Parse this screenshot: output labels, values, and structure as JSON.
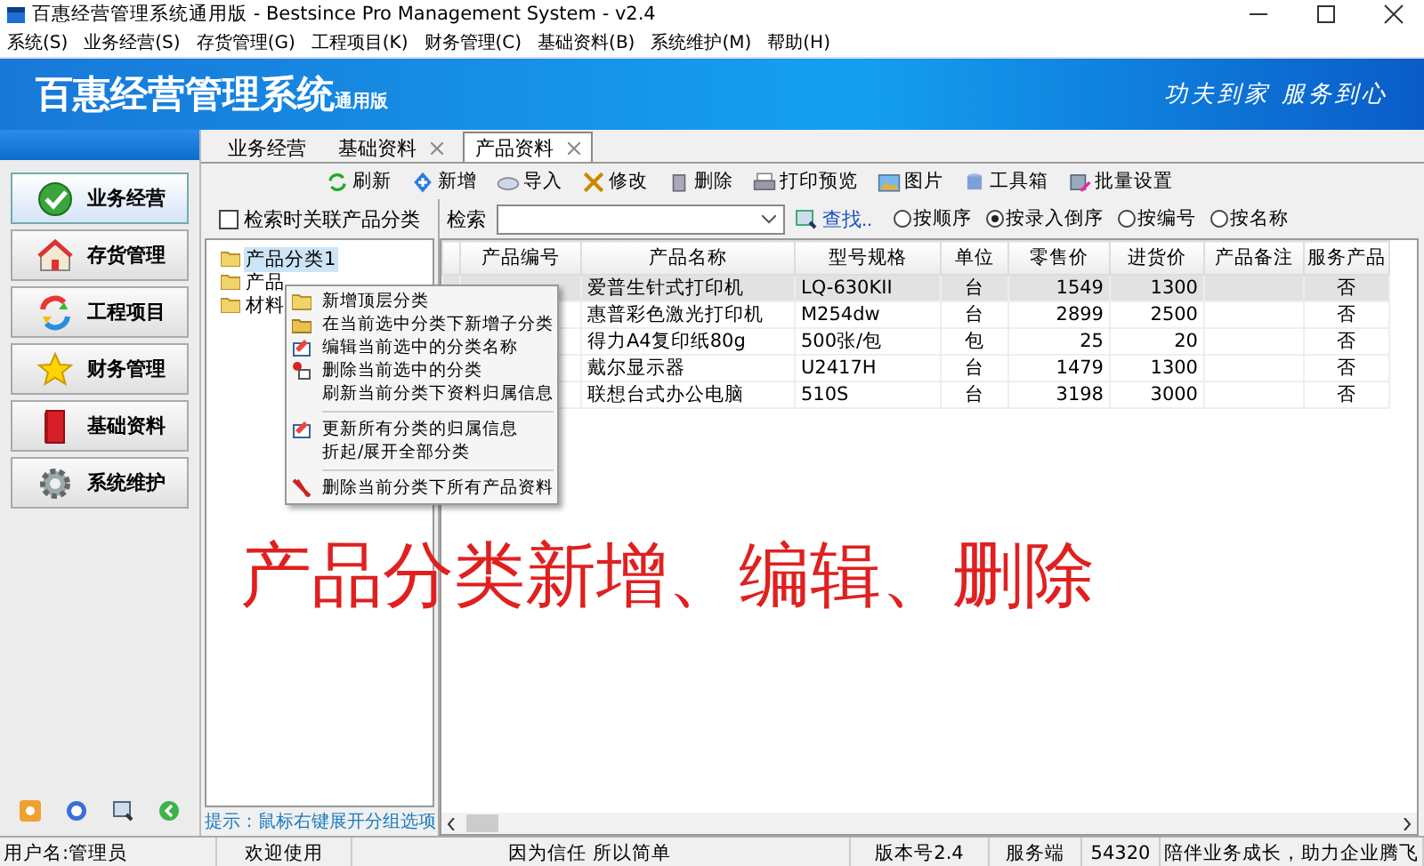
{
  "window": {
    "title": "百惠经营管理系统通用版 - Bestsince Pro Management System - v2.4"
  },
  "menu": [
    "系统(S)",
    "业务经营(S)",
    "存货管理(G)",
    "工程项目(K)",
    "财务管理(C)",
    "基础资料(B)",
    "系统维护(M)",
    "帮助(H)"
  ],
  "banner": {
    "title": "百惠经营管理系统",
    "edition": "通用版",
    "slogan": "功夫到家 服务到心"
  },
  "sidebar": {
    "items": [
      {
        "label": "业务经营",
        "selected": true
      },
      {
        "label": "存货管理",
        "selected": false
      },
      {
        "label": "工程项目",
        "selected": false
      },
      {
        "label": "财务管理",
        "selected": false
      },
      {
        "label": "基础资料",
        "selected": false
      },
      {
        "label": "系统维护",
        "selected": false
      }
    ]
  },
  "tabs": [
    {
      "label": "业务经营",
      "selected": false,
      "closable": false
    },
    {
      "label": "基础资料",
      "selected": false,
      "closable": true
    },
    {
      "label": "产品资料",
      "selected": true,
      "closable": true
    }
  ],
  "toolbar": [
    "刷新",
    "新增",
    "导入",
    "修改",
    "删除",
    "打印预览",
    "图片",
    "工具箱",
    "批量设置"
  ],
  "category_panel": {
    "link_checkbox": {
      "label": "检索时关联产品分类",
      "checked": false
    },
    "tree": [
      {
        "label": "产品分类1",
        "selected": true
      },
      {
        "label": "产品",
        "selected": false
      },
      {
        "label": "材料",
        "selected": false
      }
    ],
    "hint": "提示：鼠标右键展开分组选项"
  },
  "search": {
    "label": "检索",
    "find_button": "查找..",
    "sort_options": [
      {
        "label": "按顺序",
        "selected": false
      },
      {
        "label": "按录入倒序",
        "selected": true
      },
      {
        "label": "按编号",
        "selected": false
      },
      {
        "label": "按名称",
        "selected": false
      }
    ]
  },
  "table": {
    "columns": [
      "产品编号",
      "产品名称",
      "型号规格",
      "单位",
      "零售价",
      "进货价",
      "产品备注",
      "服务产品"
    ],
    "rows": [
      {
        "selected": true,
        "cells": [
          "",
          "爱普生针式打印机",
          "LQ-630KII",
          "台",
          "1549",
          "1300",
          "",
          "否"
        ]
      },
      {
        "selected": false,
        "cells": [
          "",
          "惠普彩色激光打印机",
          "M254dw",
          "台",
          "2899",
          "2500",
          "",
          "否"
        ]
      },
      {
        "selected": false,
        "cells": [
          "",
          "得力A4复印纸80g",
          "500张/包",
          "包",
          "25",
          "20",
          "",
          "否"
        ]
      },
      {
        "selected": false,
        "cells": [
          "",
          "戴尔显示器",
          "U2417H",
          "台",
          "1479",
          "1300",
          "",
          "否"
        ]
      },
      {
        "selected": false,
        "cells": [
          "",
          "联想台式办公电脑",
          "510S",
          "台",
          "3198",
          "3000",
          "",
          "否"
        ]
      }
    ]
  },
  "context_menu": [
    {
      "kind": "folder",
      "label": "新增顶层分类"
    },
    {
      "kind": "subfolder",
      "label": "在当前选中分类下新增子分类"
    },
    {
      "kind": "edit",
      "label": "编辑当前选中的分类名称"
    },
    {
      "kind": "delete",
      "label": "删除当前选中的分类"
    },
    {
      "kind": "plain",
      "label": "刷新当前分类下资料归属信息"
    },
    {
      "kind": "separator"
    },
    {
      "kind": "edit",
      "label": "更新所有分类的归属信息"
    },
    {
      "kind": "plain",
      "label": "折起/展开全部分类"
    },
    {
      "kind": "separator"
    },
    {
      "kind": "purge",
      "label": "删除当前分类下所有产品资料"
    }
  ],
  "overlay_caption": "产品分类新增、编辑、删除",
  "status_bar": [
    "用户名:管理员",
    "欢迎使用",
    "因为信任 所以简单",
    "版本号2.4",
    "服务端",
    "54320",
    "陪伴业务成长，助力企业腾飞"
  ]
}
